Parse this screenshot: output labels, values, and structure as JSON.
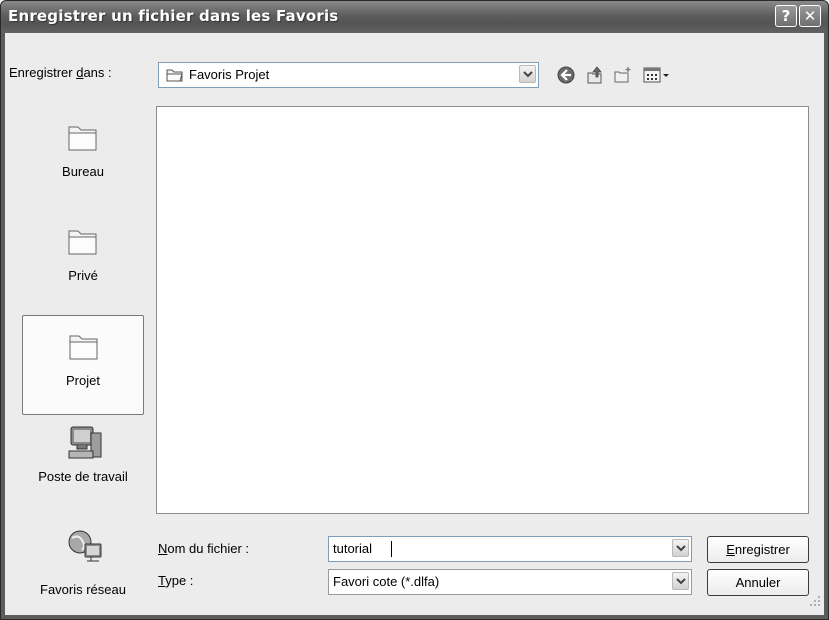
{
  "window": {
    "title": "Enregistrer un fichier dans les Favoris",
    "help_button": "?",
    "close_button": "✕"
  },
  "lookin": {
    "label_pre": "Enregistrer ",
    "label_accel": "d",
    "label_post": "ans :",
    "folder": "Favoris Projet"
  },
  "toolbar": {
    "back_icon": "back-icon",
    "up_icon": "up-folder-icon",
    "new_folder_icon": "new-folder-icon",
    "views_icon": "views-menu-icon"
  },
  "places": [
    {
      "label": "Bureau",
      "icon": "folder-icon"
    },
    {
      "label": "Privé",
      "icon": "folder-icon"
    },
    {
      "label": "Projet",
      "icon": "folder-icon"
    },
    {
      "label": "Poste de travail",
      "icon": "computer-icon"
    },
    {
      "label": "Favoris réseau",
      "icon": "network-icon"
    }
  ],
  "filename": {
    "label_accel": "N",
    "label_rest": "om du fichier :",
    "value": "tutorial"
  },
  "filetype": {
    "label_accel": "T",
    "label_rest": "ype :",
    "value": "Favori cote (*.dlfa)"
  },
  "buttons": {
    "save_accel": "E",
    "save_rest": "nregistrer",
    "cancel": "Annuler"
  }
}
